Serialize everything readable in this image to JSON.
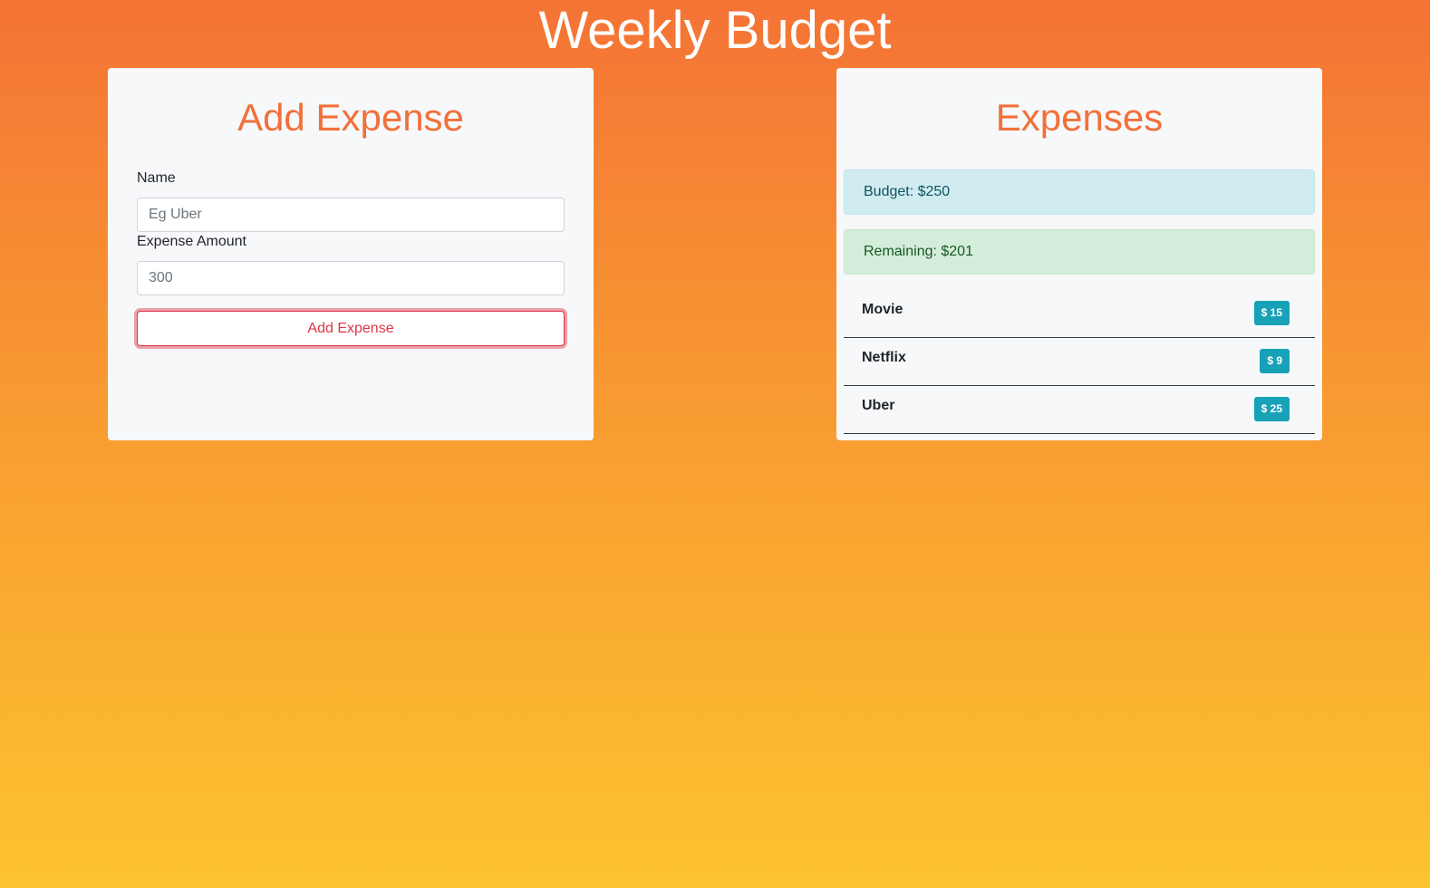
{
  "header": {
    "title": "Weekly Budget"
  },
  "add_expense": {
    "title": "Add Expense",
    "name_label": "Name",
    "name_placeholder": "Eg Uber",
    "amount_label": "Expense Amount",
    "amount_placeholder": "300",
    "submit_label": "Add Expense"
  },
  "expenses": {
    "title": "Expenses",
    "budget_text": "Budget: $250",
    "remaining_text": "Remaining: $201",
    "items": [
      {
        "name": "Movie",
        "amount": "$ 15"
      },
      {
        "name": "Netflix",
        "amount": "$ 9"
      },
      {
        "name": "Uber",
        "amount": "$ 25"
      }
    ]
  },
  "colors": {
    "accent": "#f2703a",
    "danger": "#dc3545",
    "badge": "#17a2b8",
    "gradient_top": "#f47335",
    "gradient_bottom": "#fdc32f"
  }
}
